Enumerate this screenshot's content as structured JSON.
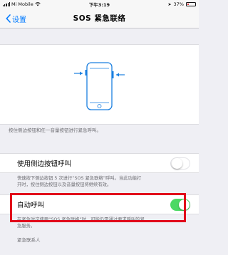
{
  "status_bar": {
    "carrier": "Mi Mobile",
    "time": "下午3:19",
    "battery": "37%",
    "battery_level": 0.37
  },
  "nav": {
    "back_label": "设置",
    "title": "SOS 紧急联络"
  },
  "illustration": {
    "icon": "phone-side-buttons-illustration"
  },
  "caption_top": "按住侧边按钮和任一音量按钮进行紧急呼叫。",
  "side_button_call": {
    "label": "使用侧边按钮呼叫",
    "enabled": false,
    "description_line1": "快速按下侧边按钮 5 次进行“SOS 紧急联络”呼叫。当此功能打",
    "description_line2": "开时，按住侧边按钮以及音量按钮将继续有效。"
  },
  "auto_call": {
    "label": "自动呼叫",
    "enabled": true,
    "description_line1": "在紧急时这使用“SOS 紧急联络”时，可能仍需通过要求呼叫的紧",
    "description_line2": "急服务。"
  },
  "emergency_contacts_header": "紧急联系人",
  "colors": {
    "accent": "#007aff",
    "toggle_on": "#4cd964",
    "highlight": "#e1001a"
  }
}
